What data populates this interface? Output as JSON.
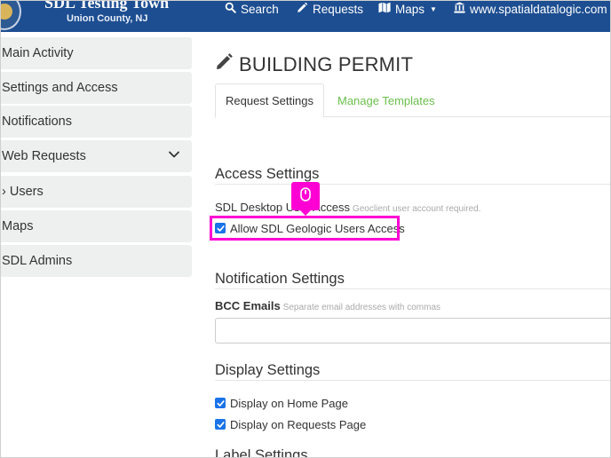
{
  "brand": {
    "title": "SDL Testing Town",
    "subtitle": "Union County, NJ"
  },
  "nav": {
    "search": "Search",
    "requests": "Requests",
    "maps": "Maps",
    "website": "www.spatialdatalogic.com"
  },
  "sidebar": {
    "items": [
      {
        "label": "Main Activity"
      },
      {
        "label": "Settings and Access"
      },
      {
        "label": "Notifications"
      },
      {
        "label": "Web Requests",
        "expandable": true
      },
      {
        "label": "› Users"
      },
      {
        "label": "Maps"
      },
      {
        "label": "SDL Admins"
      }
    ]
  },
  "main": {
    "title": "BUILDING PERMIT",
    "tabs": [
      {
        "label": "Request Settings",
        "active": true
      },
      {
        "label": "Manage Templates",
        "active": false
      }
    ],
    "access": {
      "heading": "Access Settings",
      "field_label": "SDL Desktop User Access",
      "field_hint": "Geoclient user account required.",
      "checkbox_label": "Allow SDL Geologic Users Access",
      "checked": true
    },
    "notification": {
      "heading": "Notification Settings",
      "bcc_label": "BCC Emails",
      "bcc_hint": "Separate email addresses with commas",
      "bcc_value": ""
    },
    "display": {
      "heading": "Display Settings",
      "options": [
        {
          "label": "Display on Home Page",
          "checked": true
        },
        {
          "label": "Display on Requests Page",
          "checked": true
        }
      ]
    },
    "label": {
      "heading": "Label Settings"
    }
  },
  "colors": {
    "navbar": "#1d4e91",
    "sidebar_bg": "#eef0f0",
    "link_green": "#6abf4b",
    "checkbox_blue": "#1a73e8",
    "highlight_magenta": "#ff00d4"
  },
  "icons": {
    "search": "search-icon",
    "requests": "pencil-icon",
    "maps": "map-icon",
    "website": "institution-icon",
    "title": "pencil-icon",
    "web_requests_toggle": "chevron-down-icon",
    "cursor_hint": "mouse-icon"
  }
}
